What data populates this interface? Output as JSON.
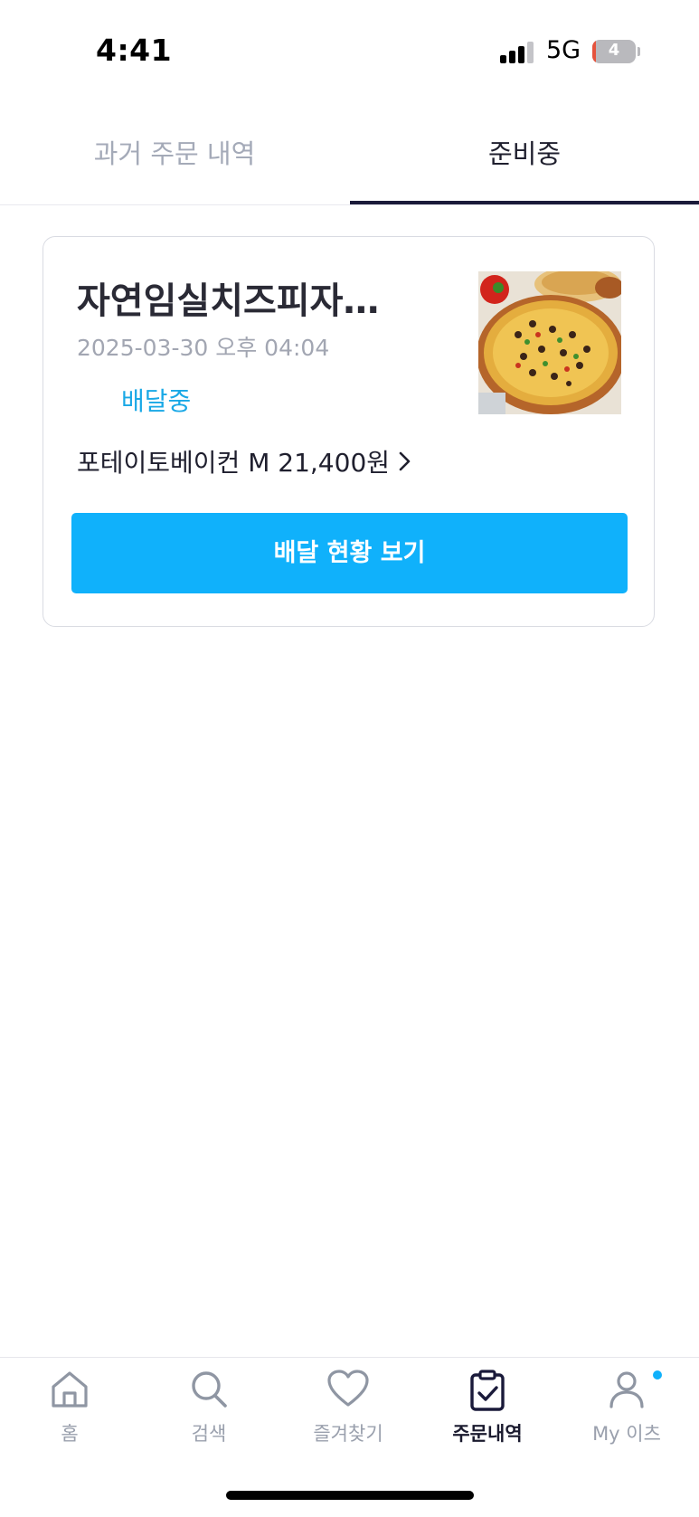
{
  "status_bar": {
    "time": "4:41",
    "network": "5G",
    "battery_level": "4",
    "battery_color": "#e5533d"
  },
  "tabs": [
    {
      "label": "과거 주문 내역",
      "active": false
    },
    {
      "label": "준비중",
      "active": true
    }
  ],
  "order": {
    "store_name": "자연임실치즈피자…",
    "date": "2025-03-30 오후 04:04",
    "status": "배달중",
    "summary": "포테이토베이컨 M 21,400원",
    "image_icon": "pizza-photo",
    "track_button_label": "배달 현황 보기"
  },
  "bottom_nav": [
    {
      "label": "홈",
      "icon": "home-icon",
      "active": false
    },
    {
      "label": "검색",
      "icon": "search-icon",
      "active": false
    },
    {
      "label": "즐겨찾기",
      "icon": "heart-icon",
      "active": false
    },
    {
      "label": "주문내역",
      "icon": "clipboard-check-icon",
      "active": true
    },
    {
      "label": "My 이츠",
      "icon": "user-icon",
      "active": false,
      "has_notification": true
    }
  ],
  "colors": {
    "accent": "#10b1fb",
    "status_text": "#19a8e6",
    "active_tab": "#1b1b3a",
    "inactive_text": "#a4aab8"
  }
}
